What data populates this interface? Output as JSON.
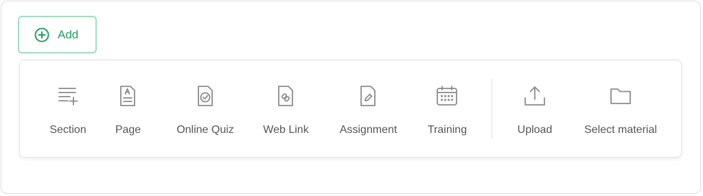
{
  "add_button": {
    "label": "Add",
    "icon": "plus-circle-icon",
    "color": "#1e9e60",
    "border_color": "#9fdcc0"
  },
  "menu": {
    "items": [
      {
        "label": "Section",
        "icon": "section-list-add-icon"
      },
      {
        "label": "Page",
        "icon": "page-document-icon"
      },
      {
        "label": "Online Quiz",
        "icon": "quiz-check-icon"
      },
      {
        "label": "Web Link",
        "icon": "link-document-icon"
      },
      {
        "label": "Assignment",
        "icon": "pencil-document-icon"
      },
      {
        "label": "Training",
        "icon": "calendar-icon"
      },
      {
        "label": "Upload",
        "icon": "upload-icon"
      },
      {
        "label": "Select material",
        "icon": "folder-icon"
      }
    ],
    "text_color": "#555555",
    "icon_color": "#8a8a8a"
  }
}
